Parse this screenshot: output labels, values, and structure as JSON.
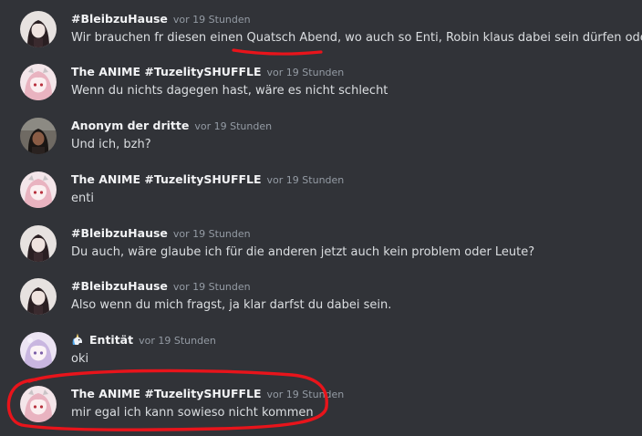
{
  "messages": [
    {
      "username": "#BleibzuHause",
      "timestamp": "vor 19 Stunden",
      "text_before": "Wir brauchen fr diesen einen ",
      "text_highlight": "Quatsch Abend",
      "text_after": ", wo auch so Enti, Robin klaus dabei sein dürfen oder?",
      "avatar": "dark-hair-avatar"
    },
    {
      "username": "The ANIME #TuzelitySHUFFLE",
      "timestamp": "vor 19 Stunden",
      "text": "Wenn du nichts dagegen hast, wäre es nicht schlecht",
      "avatar": "anime-pink-avatar"
    },
    {
      "username": "Anonym der dritte",
      "timestamp": "vor 19 Stunden",
      "text": "Und ich, bzh?",
      "avatar": "photo-avatar"
    },
    {
      "username": "The ANIME #TuzelitySHUFFLE",
      "timestamp": "vor 19 Stunden",
      "text": "enti",
      "avatar": "anime-pink-avatar"
    },
    {
      "username": "#BleibzuHause",
      "timestamp": "vor 19 Stunden",
      "text": "Du auch, wäre glaube ich für die anderen jetzt auch kein problem oder Leute?",
      "avatar": "dark-hair-avatar"
    },
    {
      "username": "#BleibzuHause",
      "timestamp": "vor 19 Stunden",
      "text": "Also wenn du mich fragst, ja klar darfst du dabei sein.",
      "avatar": "dark-hair-avatar"
    },
    {
      "username": "Entität",
      "timestamp": "vor 19 Stunden",
      "text": "oki",
      "avatar": "anime-lilac-avatar",
      "role_icon": "unicorn-icon"
    },
    {
      "username": "The ANIME #TuzelitySHUFFLE",
      "timestamp": "vor 19 Stunden",
      "text": "mir egal ich kann sowieso nicht kommen",
      "avatar": "anime-pink-avatar"
    }
  ],
  "colors": {
    "background": "#313338",
    "username": "#f2f3f5",
    "timestamp": "#949ba4",
    "message_text": "#dbdee1",
    "annotation_red": "#e8141b"
  }
}
